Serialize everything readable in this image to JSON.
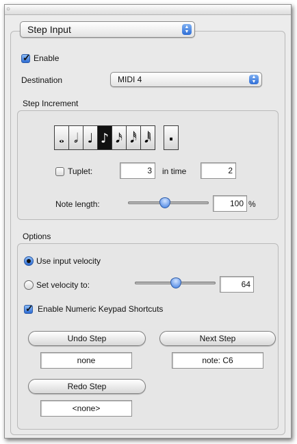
{
  "header": {
    "mode_popup": "Step Input"
  },
  "enable": {
    "label": "Enable",
    "checked": true
  },
  "destination": {
    "label": "Destination",
    "value": "MIDI 4"
  },
  "step_increment": {
    "title": "Step Increment",
    "notes": [
      {
        "name": "whole-note",
        "glyph": "𝅝"
      },
      {
        "name": "half-note",
        "glyph": "𝅗𝅥"
      },
      {
        "name": "quarter-note",
        "glyph": "♩"
      },
      {
        "name": "eighth-note",
        "glyph": "♪",
        "selected": true
      },
      {
        "name": "sixteenth-note",
        "glyph": "𝅘𝅥𝅯"
      },
      {
        "name": "thirty-second-note",
        "glyph": "𝅘𝅥𝅰"
      },
      {
        "name": "sixty-fourth-note",
        "glyph": "𝅘𝅥𝅱"
      }
    ],
    "dot_glyph": ".",
    "tuplet": {
      "label": "Tuplet:",
      "value": "3",
      "in_time_label": "in time",
      "in_time_value": "2",
      "checked": false
    },
    "note_length": {
      "label": "Note length:",
      "value": "100",
      "unit": "%",
      "slider_fraction": 0.5
    }
  },
  "options": {
    "title": "Options",
    "use_input_velocity": {
      "label": "Use input velocity",
      "selected": true
    },
    "set_velocity": {
      "label": "Set velocity to:",
      "value": "64",
      "slider_fraction": 0.5
    },
    "numeric_keypad": {
      "label": "Enable Numeric Keypad Shortcuts",
      "checked": true
    },
    "undo_step": {
      "label": "Undo Step",
      "readout": "none"
    },
    "next_step": {
      "label": "Next Step",
      "readout": "note: C6"
    },
    "redo_step": {
      "label": "Redo Step",
      "readout": "<none>"
    }
  }
}
